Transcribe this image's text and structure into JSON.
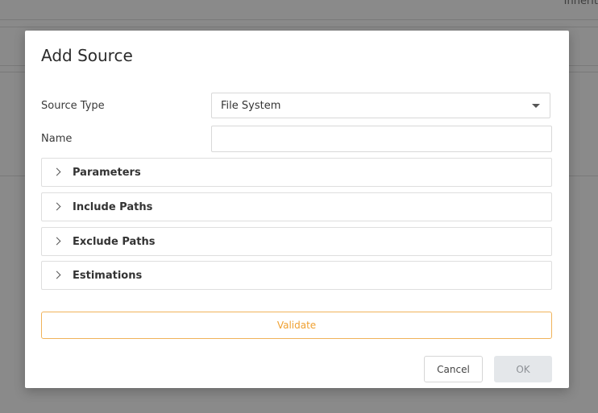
{
  "background": {
    "corner_text": "Inherit"
  },
  "dialog": {
    "title": "Add Source",
    "source_type": {
      "label": "Source Type",
      "value": "File System"
    },
    "name": {
      "label": "Name",
      "value": "",
      "placeholder": ""
    },
    "panels": [
      {
        "label": "Parameters"
      },
      {
        "label": "Include Paths"
      },
      {
        "label": "Exclude Paths"
      },
      {
        "label": "Estimations"
      }
    ],
    "validate_label": "Validate",
    "cancel_label": "Cancel",
    "ok_label": "OK"
  },
  "colors": {
    "accent": "#f0a030",
    "overlay": "rgba(0,0,0,0.42)"
  }
}
